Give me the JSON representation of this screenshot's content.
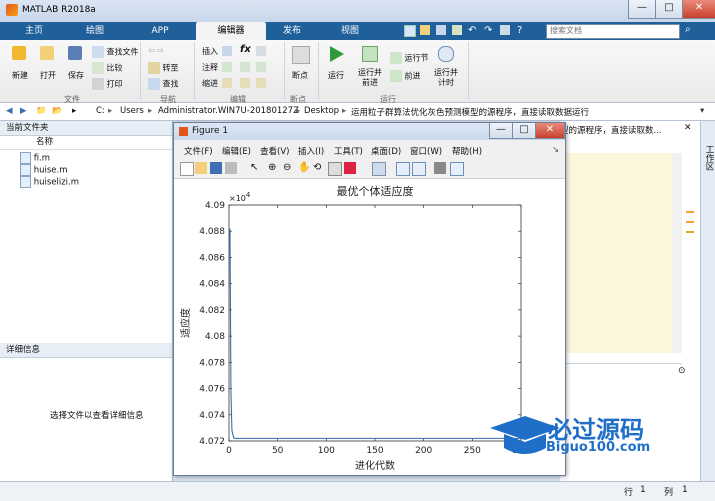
{
  "app": {
    "title": "MATLAB R2018a"
  },
  "search": {
    "placeholder": "搜索文档"
  },
  "tabs": [
    "主页",
    "绘图",
    "APP",
    "编辑器",
    "发布",
    "视图"
  ],
  "toolstrip": {
    "file": {
      "new": "新建",
      "open": "打开",
      "save": "保存",
      "find_files": "查找文件",
      "compare": "比较",
      "print": "打印",
      "section": "文件"
    },
    "nav": {
      "goto": "转至",
      "find": "查找",
      "section": "导航"
    },
    "edit": {
      "insert": "插入",
      "comment": "注释",
      "indent": "缩进",
      "fx": "fx",
      "section": "编辑"
    },
    "breakpoints": {
      "label": "断点",
      "section": "断点"
    },
    "run": {
      "run": "运行",
      "run_advance": "运行并\n前进",
      "run_section": "运行节",
      "advance": "前进",
      "run_time": "运行并\n计时",
      "section": "运行"
    }
  },
  "address": {
    "path": [
      "C:",
      "Users",
      "Administrator.WIN7U-20180127Z",
      "Desktop",
      "运用粒子群算法优化灰色预测模型的源程序，直接读取数据运行"
    ]
  },
  "left_panel": {
    "title": "当前文件夹",
    "col_name": "名称",
    "files": [
      "fi.m",
      "huise.m",
      "huiselizi.m"
    ],
    "details_title": "详细信息",
    "details_msg": "选择文件以查看详细信息"
  },
  "right_area": {
    "text": "型的源程序，直接读取数...",
    "side_label": "工作区"
  },
  "status": {
    "row_label": "行",
    "row": "1",
    "col_label": "列",
    "col": "1"
  },
  "figure": {
    "title": "Figure 1",
    "menus": [
      "文件(F)",
      "编辑(E)",
      "查看(V)",
      "插入(I)",
      "工具(T)",
      "桌面(D)",
      "窗口(W)",
      "帮助(H)"
    ],
    "buttons": {
      "minimize": "—",
      "maximize": "□",
      "close": "✕"
    }
  },
  "watermark": {
    "cn": "必过源码",
    "en": "Biguo100.com"
  },
  "chart_data": {
    "type": "line",
    "title": "最优个体适应度",
    "xlabel": "进化代数",
    "ylabel": "适应度",
    "y_multiplier": "×10^4",
    "xlim": [
      0,
      300
    ],
    "ylim": [
      4.072,
      4.09
    ],
    "xticks": [
      0,
      50,
      100,
      150,
      200,
      250,
      300
    ],
    "yticks": [
      4.072,
      4.074,
      4.076,
      4.078,
      4.08,
      4.082,
      4.084,
      4.086,
      4.088,
      4.09
    ],
    "ytick_labels": [
      "4.072",
      "4.074",
      "4.076",
      "4.078",
      "4.08",
      "4.082",
      "4.084",
      "4.086",
      "4.088",
      "4.09"
    ],
    "x": [
      1,
      2,
      3,
      5,
      300
    ],
    "y": [
      4.0882,
      4.0758,
      4.0728,
      4.0722,
      4.0722
    ],
    "color": "#2f6fb5"
  }
}
